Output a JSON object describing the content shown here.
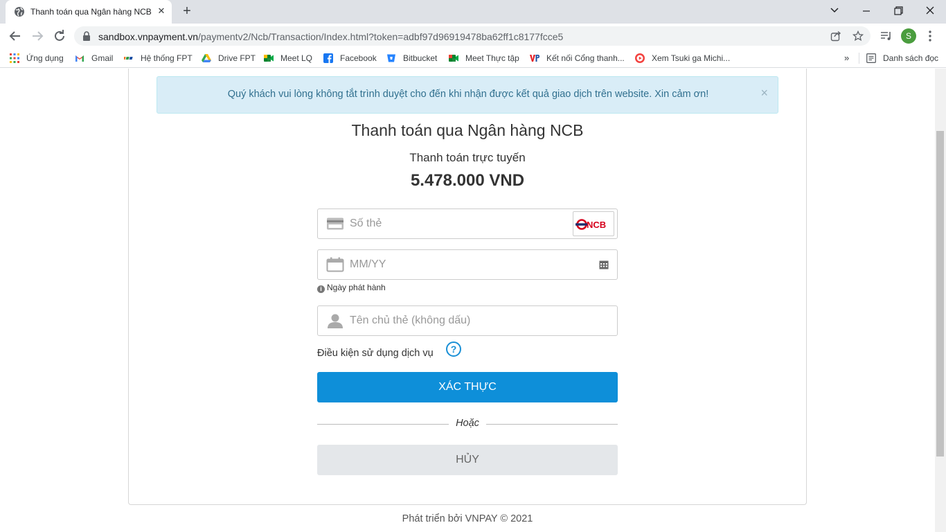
{
  "browser": {
    "tab_title": "Thanh toán qua Ngân hàng NCB",
    "url_host": "sandbox.vnpayment.vn",
    "url_path": "/paymentv2/Ncb/Transaction/Index.html?token=adbf97d96919478ba62ff1c8177fcce5",
    "profile_initial": "S",
    "profile_color": "#4a9d3e",
    "bookmarks": [
      {
        "label": "Ứng dụng",
        "icon": "apps-grid-icon"
      },
      {
        "label": "Gmail",
        "icon": "gmail-icon"
      },
      {
        "label": "Hệ thống FPT",
        "icon": "fpt-icon"
      },
      {
        "label": "Drive FPT",
        "icon": "drive-icon"
      },
      {
        "label": "Meet LQ",
        "icon": "meet-icon"
      },
      {
        "label": "Facebook",
        "icon": "facebook-icon"
      },
      {
        "label": "Bitbucket",
        "icon": "bitbucket-icon"
      },
      {
        "label": "Meet Thực tập",
        "icon": "meet-icon"
      },
      {
        "label": "Kết nối Cổng thanh...",
        "icon": "vnpay-icon"
      },
      {
        "label": "Xem Tsuki ga Michi...",
        "icon": "play-icon"
      }
    ],
    "reading_list": "Danh sách đọc"
  },
  "page": {
    "alert": "Quý khách vui lòng không tắt trình duyệt cho đến khi nhận được kết quả giao dịch trên website. Xin cảm ơn!",
    "title": "Thanh toán qua Ngân hàng NCB",
    "subtitle": "Thanh toán trực tuyến",
    "amount": "5.478.000 VND",
    "card_number_placeholder": "Số thẻ",
    "bank_logo_text": "NCB",
    "date_placeholder": "MM/YY",
    "date_hint": "Ngày phát hành",
    "holder_placeholder": "Tên chủ thẻ (không dấu)",
    "terms": "Điều kiện sử dụng dịch vụ",
    "help": "?",
    "submit": "Xác thực",
    "or": "Hoặc",
    "cancel": "HỦY",
    "footer": "Phát triển bởi VNPAY © 2021"
  },
  "colors": {
    "primary": "#0e8fd9",
    "alert_bg": "#d9edf7",
    "alert_text": "#31708f",
    "cancel_bg": "#e4e7ea",
    "ncb_red": "#d6001c",
    "ncb_navy": "#1d2d6b"
  }
}
